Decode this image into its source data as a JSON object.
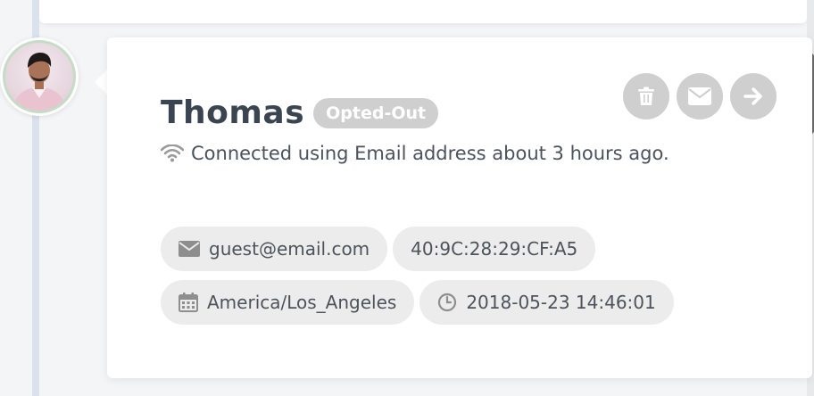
{
  "contact": {
    "name": "Thomas",
    "status": "Opted-Out",
    "connection_text": "Connected using Email address about 3 hours ago."
  },
  "actions": [
    {
      "name": "delete",
      "icon": "trash-icon"
    },
    {
      "name": "email",
      "icon": "envelope-icon"
    },
    {
      "name": "open",
      "icon": "arrow-right-icon"
    }
  ],
  "details": {
    "email": "guest@email.com",
    "mac_address": "40:9C:28:29:CF:A5",
    "timezone": "America/Los_Angeles",
    "timestamp": "2018-05-23 14:46:01"
  },
  "colors": {
    "badge": "#cfcfcf",
    "chip_bg": "#ececec",
    "timeline": "#d9e2ed",
    "avatar_ring": "#c5dcc7"
  }
}
